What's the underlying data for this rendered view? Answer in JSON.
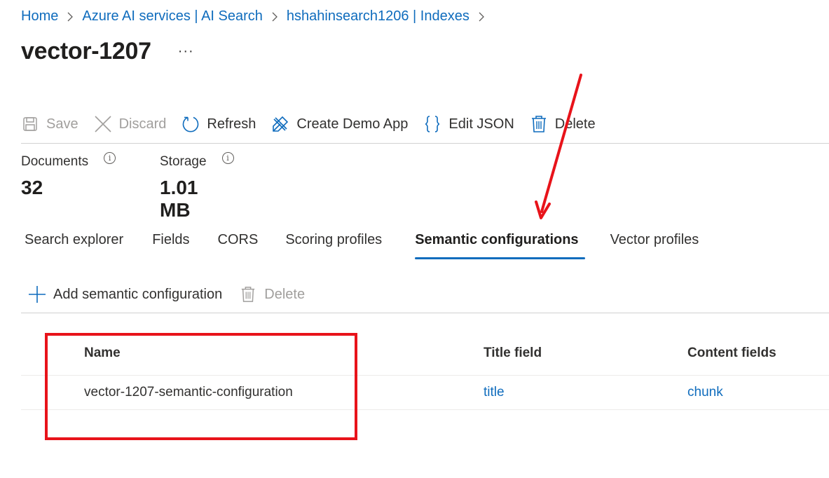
{
  "breadcrumb": {
    "items": [
      "Home",
      "Azure AI services | AI Search",
      "hshahinsearch1206 | Indexes"
    ]
  },
  "page": {
    "title": "vector-1207",
    "more_label": "···"
  },
  "toolbar": {
    "save": "Save",
    "discard": "Discard",
    "refresh": "Refresh",
    "create_demo_app": "Create Demo App",
    "edit_json": "Edit JSON",
    "delete": "Delete"
  },
  "stats": {
    "documents": {
      "label": "Documents",
      "value": "32",
      "info_icon": "info-icon"
    },
    "storage": {
      "label": "Storage",
      "value": "1.01 MB",
      "info_icon": "info-icon"
    }
  },
  "tabs": {
    "items": [
      "Search explorer",
      "Fields",
      "CORS",
      "Scoring profiles",
      "Semantic configurations",
      "Vector profiles"
    ],
    "active": "Semantic configurations"
  },
  "subtoolbar": {
    "add": "Add semantic configuration",
    "delete": "Delete"
  },
  "table": {
    "columns": [
      "Name",
      "Title field",
      "Content fields"
    ],
    "rows": [
      {
        "name": "vector-1207-semantic-configuration",
        "title_field": "title",
        "content_fields": "chunk"
      }
    ]
  },
  "colors": {
    "accent": "#0f6cbd",
    "annotation": "#e8131a",
    "disabled": "#a19f9d"
  }
}
